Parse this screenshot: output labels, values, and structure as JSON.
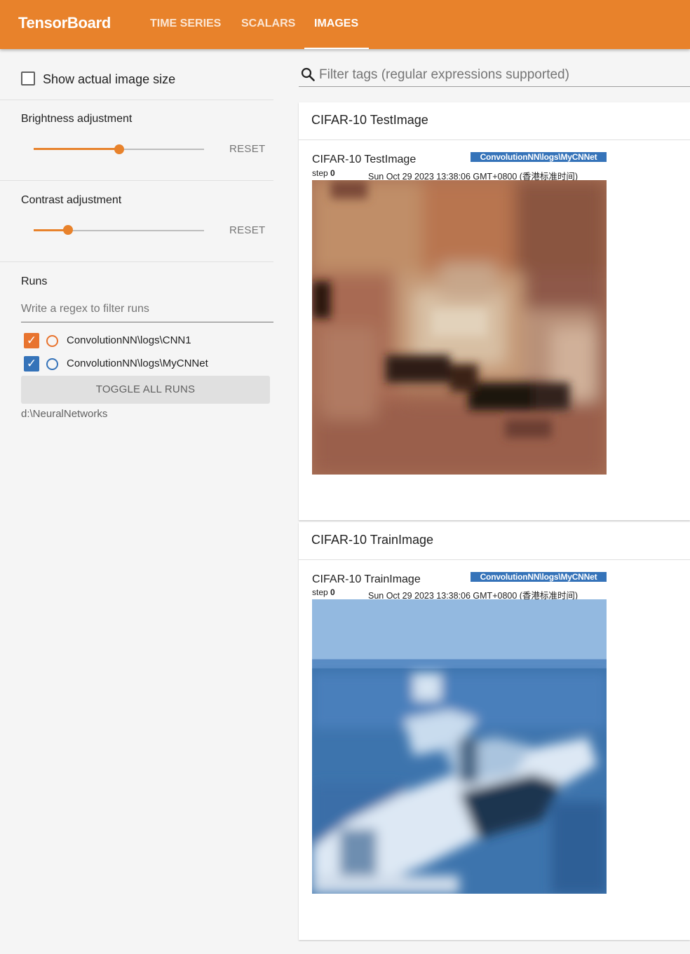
{
  "app": {
    "brand": "TensorBoard",
    "tabs": [
      {
        "label": "TIME SERIES",
        "active": false
      },
      {
        "label": "SCALARS",
        "active": false
      },
      {
        "label": "IMAGES",
        "active": true
      }
    ],
    "accent_color": "#e8822b"
  },
  "sidebar": {
    "show_actual_size_label": "Show actual image size",
    "show_actual_size_checked": false,
    "brightness": {
      "label": "Brightness adjustment",
      "reset_label": "RESET",
      "value": 0.5
    },
    "contrast": {
      "label": "Contrast adjustment",
      "reset_label": "RESET",
      "value": 0.2
    },
    "runs": {
      "title": "Runs",
      "filter_placeholder": "Write a regex to filter runs",
      "items": [
        {
          "label": "ConvolutionNN\\logs\\CNN1",
          "checked": true,
          "color": "#e8742f"
        },
        {
          "label": "ConvolutionNN\\logs\\MyCNNet",
          "checked": true,
          "color": "#3573b9"
        }
      ],
      "toggle_label": "TOGGLE ALL RUNS",
      "logdir": "d:\\NeuralNetworks"
    }
  },
  "main": {
    "filter_placeholder": "Filter tags (regular expressions supported)",
    "cards": [
      {
        "title": "CIFAR-10 TestImage",
        "image_title": "CIFAR-10 TestImage",
        "run": "ConvolutionNN\\logs\\MyCNNet",
        "step_label": "step",
        "step_value": "0",
        "timestamp": "Sun Oct 29 2023 13:38:06 GMT+0800 (香港标准时间)",
        "image": "cat-image"
      },
      {
        "title": "CIFAR-10 TrainImage",
        "image_title": "CIFAR-10 TrainImage",
        "run": "ConvolutionNN\\logs\\MyCNNet",
        "step_label": "step",
        "step_value": "0",
        "timestamp": "Sun Oct 29 2023 13:38:06 GMT+0800 (香港标准时间)",
        "image": "ship-image"
      }
    ]
  }
}
